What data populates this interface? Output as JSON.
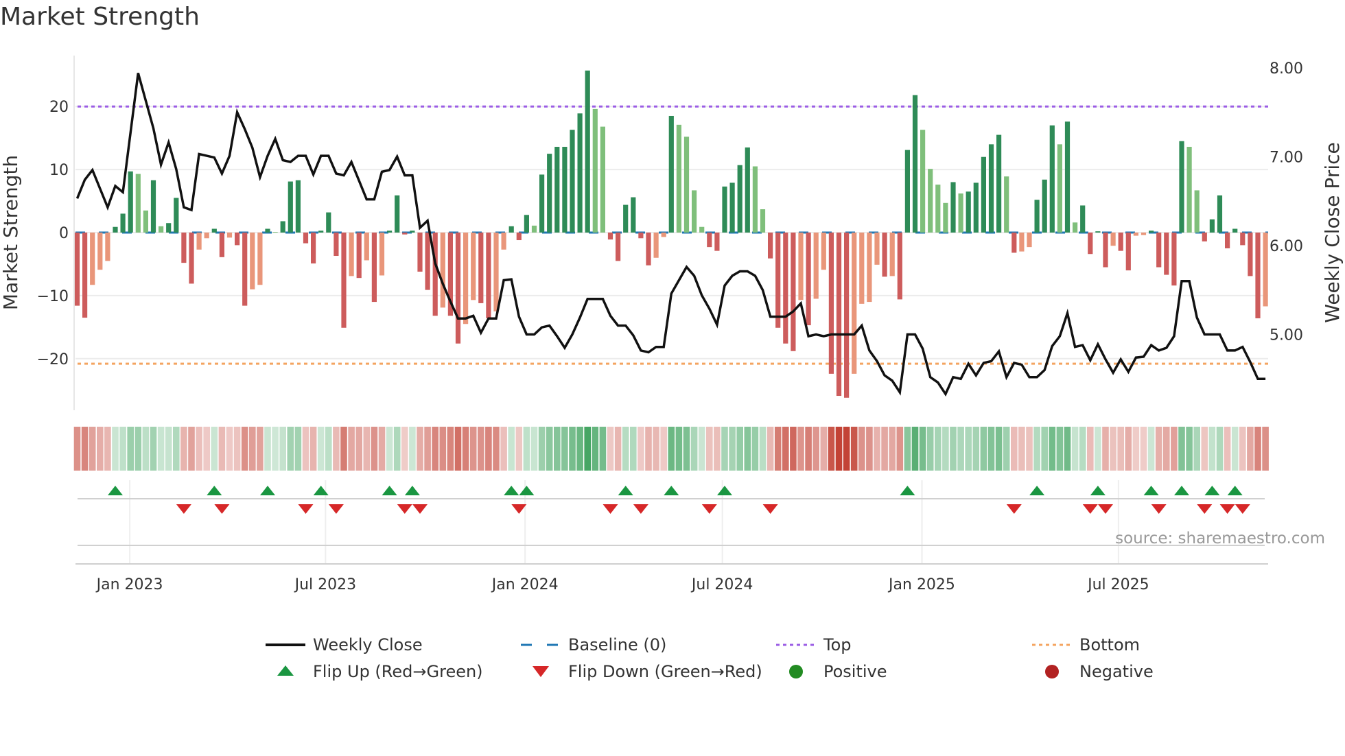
{
  "title": "Market Strength",
  "source_text": "source: sharemaestro.com",
  "colors": {
    "pos_strong": "#2e8b57",
    "pos_weak": "#7fbf7b",
    "neg_strong": "#cd5c5c",
    "neg_weak": "#e9967a",
    "close": "#111111",
    "baseline": "#1f77b4",
    "top": "#9b5de5",
    "bottom": "#f4a460",
    "flip_up": "#1a9641",
    "flip_down": "#d62728",
    "positive": "#228b22",
    "negative": "#b22222"
  },
  "legend": [
    {
      "label": "Weekly Close",
      "kind": "line"
    },
    {
      "label": "Baseline (0)",
      "kind": "baseline"
    },
    {
      "label": "Top",
      "kind": "top"
    },
    {
      "label": "Bottom",
      "kind": "bottom"
    },
    {
      "label": "Flip Up (Red→Green)",
      "kind": "flip_up"
    },
    {
      "label": "Flip Down (Green→Red)",
      "kind": "flip_down"
    },
    {
      "label": "Positive",
      "kind": "positive"
    },
    {
      "label": "Negative",
      "kind": "negative"
    }
  ],
  "chart_data": {
    "type": "bar",
    "title": "Market Strength",
    "ylabel": "Market Strength",
    "y2label": "Weekly Close Price",
    "ylim": [
      -28,
      28
    ],
    "y2lim": [
      4.15,
      8.13
    ],
    "yticks": [
      "−20",
      "−10",
      "0",
      "10",
      "20"
    ],
    "ytick_values": [
      -20,
      -10,
      0,
      10,
      20
    ],
    "y2ticks": [
      "5.00",
      "6.00",
      "7.00",
      "8.00"
    ],
    "y2tick_values": [
      5,
      6,
      7,
      8
    ],
    "top_level": 20.0,
    "bottom_level": -20.8,
    "xticks": [
      {
        "label": "Jan 2023",
        "week": 6.9
      },
      {
        "label": "Jul 2023",
        "week": 32.6
      },
      {
        "label": "Jan 2024",
        "week": 58.8
      },
      {
        "label": "Jul 2024",
        "week": 84.7
      },
      {
        "label": "Jan 2025",
        "week": 110.9
      },
      {
        "label": "Jul 2025",
        "week": 136.7
      }
    ],
    "strength": [
      -11.6,
      -13.5,
      -8.3,
      -5.9,
      -4.5,
      0.9,
      3.0,
      9.7,
      9.3,
      3.5,
      8.3,
      1.0,
      1.5,
      5.5,
      -4.8,
      -8.1,
      -2.7,
      -0.9,
      0.6,
      -3.9,
      -0.8,
      -2.0,
      -11.6,
      -9.0,
      -8.3,
      0.6,
      0.1,
      1.8,
      8.1,
      8.3,
      -1.7,
      -4.9,
      0.3,
      3.2,
      -3.7,
      -15.1,
      -6.9,
      -7.2,
      -4.4,
      -11.0,
      -6.8,
      0.3,
      5.9,
      -0.3,
      0.3,
      -6.2,
      -9.1,
      -13.2,
      -11.9,
      -13.2,
      -17.6,
      -14.5,
      -10.7,
      -11.2,
      -13.6,
      -12.5,
      -2.7,
      1.0,
      -1.2,
      2.8,
      1.1,
      9.2,
      12.5,
      13.6,
      13.6,
      16.3,
      18.9,
      25.7,
      19.6,
      16.8,
      -1.1,
      -4.5,
      4.4,
      5.6,
      -0.9,
      -5.2,
      -4.0,
      -0.7,
      18.5,
      17.1,
      15.2,
      6.7,
      0.9,
      -2.3,
      -2.9,
      7.3,
      7.9,
      10.7,
      13.5,
      10.5,
      3.7,
      -4.1,
      -15.1,
      -17.6,
      -18.8,
      -10.7,
      -14.7,
      -10.5,
      -5.9,
      -22.4,
      -25.9,
      -26.2,
      -22.4,
      -11.3,
      -11.0,
      -5.1,
      -7.0,
      -6.9,
      -10.6,
      13.1,
      21.8,
      16.3,
      10.1,
      7.6,
      4.7,
      8.0,
      6.2,
      6.5,
      7.9,
      12.0,
      14.0,
      15.5,
      8.9,
      -3.2,
      -3.0,
      -2.3,
      5.2,
      8.4,
      17.0,
      14.0,
      17.6,
      1.6,
      4.3,
      -3.4,
      0.2,
      -5.5,
      -2.1,
      -2.9,
      -6.0,
      -0.5,
      -0.4,
      0.3,
      -5.5,
      -6.7,
      -8.4,
      14.5,
      13.6,
      6.7,
      -1.4,
      2.1,
      5.9,
      -2.5,
      0.6,
      -2.0,
      -6.9,
      -13.6,
      -11.7
    ],
    "close": [
      6.53,
      6.74,
      6.85,
      6.64,
      6.43,
      6.67,
      6.6,
      7.27,
      7.94,
      7.63,
      7.32,
      6.91,
      7.16,
      6.86,
      6.43,
      6.4,
      7.03,
      7.01,
      6.99,
      6.81,
      7.01,
      7.5,
      7.31,
      7.1,
      6.77,
      7.01,
      7.2,
      6.96,
      6.94,
      7.01,
      7.01,
      6.8,
      7.01,
      7.01,
      6.81,
      6.79,
      6.94,
      6.73,
      6.52,
      6.52,
      6.83,
      6.85,
      7.0,
      6.79,
      6.79,
      6.2,
      6.28,
      5.8,
      5.57,
      5.37,
      5.18,
      5.18,
      5.21,
      5.02,
      5.18,
      5.18,
      5.61,
      5.62,
      5.2,
      5.0,
      5.0,
      5.08,
      5.1,
      4.98,
      4.85,
      5.0,
      5.19,
      5.4,
      5.4,
      5.4,
      5.21,
      5.1,
      5.1,
      4.99,
      4.82,
      4.8,
      4.86,
      4.86,
      5.46,
      5.61,
      5.76,
      5.66,
      5.44,
      5.29,
      5.11,
      5.55,
      5.66,
      5.71,
      5.71,
      5.66,
      5.5,
      5.2,
      5.2,
      5.2,
      5.26,
      5.35,
      4.98,
      5.0,
      4.98,
      5.0,
      5.0,
      5.0,
      5.0,
      5.1,
      4.82,
      4.7,
      4.54,
      4.48,
      4.35,
      5.0,
      5.0,
      4.84,
      4.52,
      4.46,
      4.33,
      4.52,
      4.5,
      4.67,
      4.54,
      4.68,
      4.7,
      4.81,
      4.52,
      4.68,
      4.66,
      4.52,
      4.52,
      4.6,
      4.87,
      4.98,
      5.24,
      4.86,
      4.88,
      4.71,
      4.89,
      4.72,
      4.57,
      4.72,
      4.58,
      4.74,
      4.75,
      4.88,
      4.82,
      4.85,
      4.98,
      5.6,
      5.6,
      5.19,
      5.0,
      5.0,
      5.0,
      4.82,
      4.82,
      4.86,
      4.69,
      4.5,
      4.5
    ],
    "flip_up_weeks": [
      5,
      18,
      25,
      32,
      41,
      44,
      57,
      59,
      72,
      78,
      85,
      109,
      126,
      134,
      141,
      145,
      149,
      152
    ],
    "flip_down_weeks": [
      14,
      19,
      30,
      34,
      43,
      45,
      58,
      70,
      74,
      83,
      91,
      123,
      133,
      135,
      142,
      148,
      151,
      153
    ],
    "legend_placement": "bottom-center"
  }
}
